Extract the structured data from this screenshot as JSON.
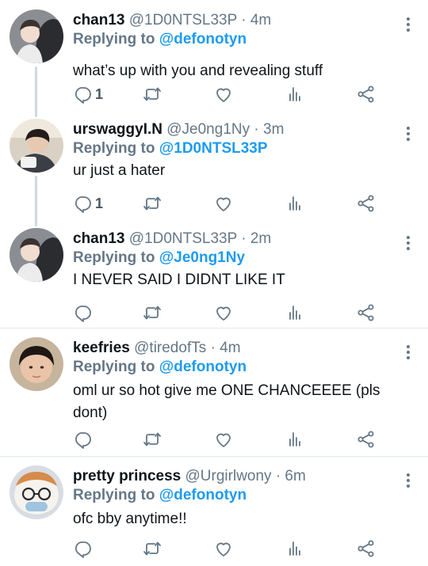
{
  "icons": {
    "reply": "reply-icon",
    "retweet": "retweet-icon",
    "like": "heart-icon",
    "analytics": "analytics-icon",
    "share": "share-icon",
    "more": "more-icon"
  },
  "colors": {
    "link": "#1d9bf0",
    "secondary": "#657786",
    "icon": "#657786",
    "divider": "#e1e8ed"
  },
  "tweets": [
    {
      "name": "chan13",
      "handle": "@1D0NTSL33P",
      "time": "· 4m",
      "reply_label": "Replying to",
      "reply_to": "@defonotyn",
      "text": "what’s up with you and revealing stuff",
      "reply_count": "1"
    },
    {
      "name": "urswaggyI.N",
      "handle": "@Je0ng1Ny",
      "time": "· 3m",
      "reply_label": "Replying to",
      "reply_to": "@1D0NTSL33P",
      "text": "ur just a hater",
      "reply_count": "1"
    },
    {
      "name": "chan13",
      "handle": "@1D0NTSL33P",
      "time": "· 2m",
      "reply_label": "Replying to",
      "reply_to": "@Je0ng1Ny",
      "text": "I NEVER SAID I DIDNT LIKE IT",
      "reply_count": ""
    },
    {
      "name": "keefries",
      "handle": "@tiredofTs",
      "time": "· 4m",
      "reply_label": "Replying to",
      "reply_to": "@defonotyn",
      "text": "oml ur so hot give me ONE CHANCEEEE (pls dont)",
      "reply_count": ""
    },
    {
      "name": "pretty princess",
      "handle": "@Urgirlwony",
      "time": "· 6m",
      "reply_label": "Replying to",
      "reply_to": "@defonotyn",
      "text": "ofc bby anytime!!",
      "reply_count": ""
    }
  ]
}
